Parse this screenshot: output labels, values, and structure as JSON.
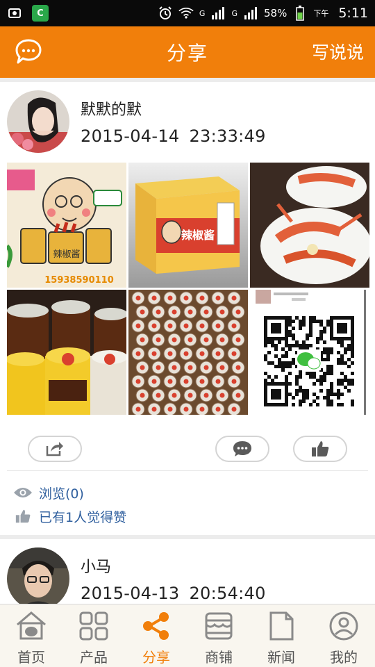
{
  "status_bar": {
    "battery": "58%",
    "ampm": "下午",
    "time": "5:11",
    "signal_label_1": "G",
    "signal_label_2": "G",
    "app_icon": "C",
    "icons": [
      "screenshot-icon",
      "app-c-icon",
      "alarm-icon",
      "wifi-icon",
      "signal-icon",
      "battery-icon"
    ]
  },
  "header": {
    "title": "分享",
    "compose_label": "写说说",
    "accent": "#f17f0b"
  },
  "posts": [
    {
      "name": "默默的默",
      "date": "2015-04-14",
      "time": "23:33:49",
      "photo_texts": {
        "p1_brand": "辣椒酱",
        "p1_phone": "15938590110",
        "p2_brand": "辣椒酱"
      },
      "views_label": "浏览(0)",
      "likes_label": "已有1人觉得赞"
    },
    {
      "name": "小马",
      "date": "2015-04-13",
      "time": "20:54:40"
    }
  ],
  "nav": {
    "items": [
      {
        "label": "首页",
        "icon": "home-icon"
      },
      {
        "label": "产品",
        "icon": "grid-icon"
      },
      {
        "label": "分享",
        "icon": "share-icon"
      },
      {
        "label": "商铺",
        "icon": "shop-icon"
      },
      {
        "label": "新闻",
        "icon": "news-icon"
      },
      {
        "label": "我的",
        "icon": "profile-icon"
      }
    ],
    "active_index": 2
  }
}
